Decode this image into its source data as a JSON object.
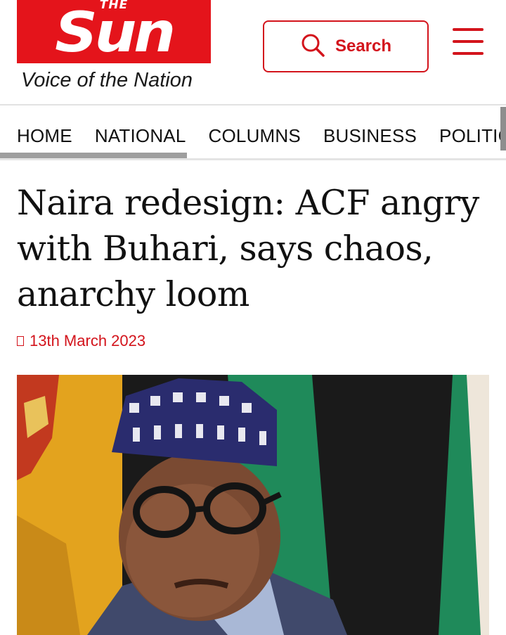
{
  "header": {
    "logo": {
      "the": "THE",
      "name": "Sun"
    },
    "tagline": "Voice of the Nation",
    "search_label": "Search",
    "colors": {
      "brand_red": "#e4141b",
      "accent_red": "#d3141c"
    }
  },
  "nav": {
    "items": [
      {
        "label": "HOME"
      },
      {
        "label": "NATIONAL"
      },
      {
        "label": "COLUMNS"
      },
      {
        "label": "BUSINESS"
      },
      {
        "label": "POLITIC"
      }
    ]
  },
  "article": {
    "headline": "Naira redesign: ACF angry with Buhari, says chaos, anarchy loom",
    "date": "13th March 2023",
    "date_icon": "calendar-icon",
    "image": "photo-of-man-in-cap-and-glasses"
  }
}
